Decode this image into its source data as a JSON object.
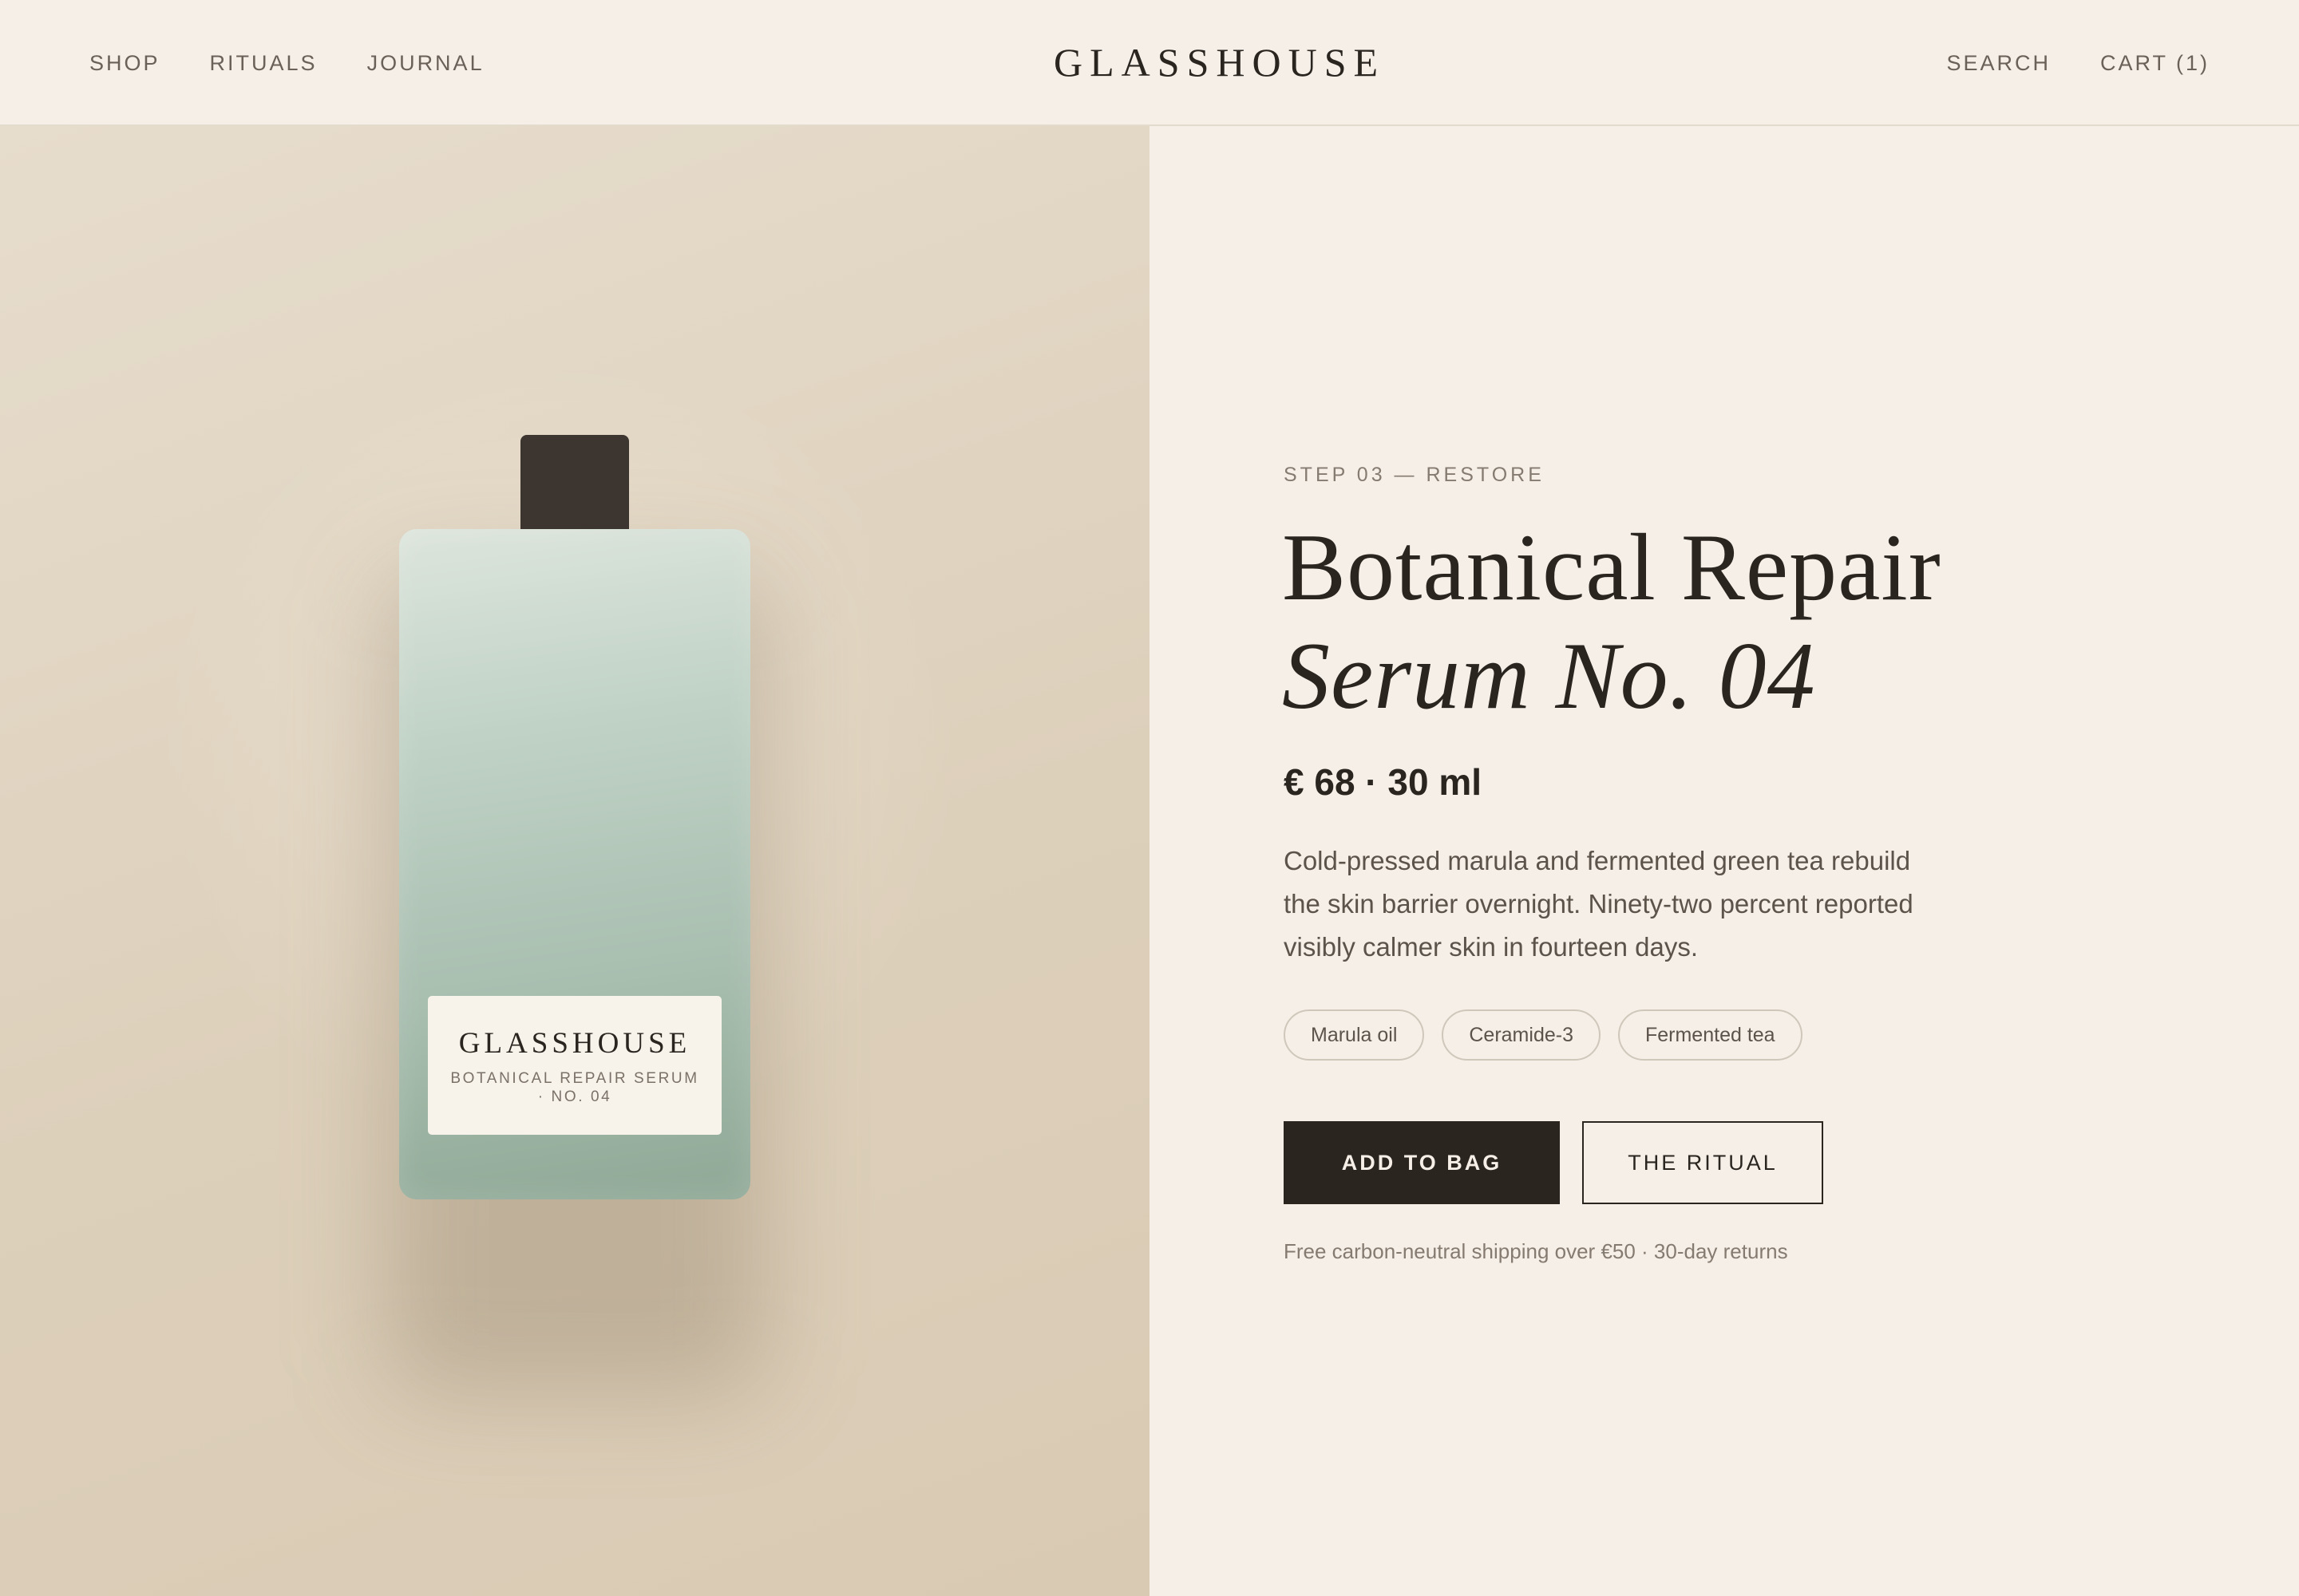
{
  "header": {
    "nav_left": [
      "SHOP",
      "RITUALS",
      "JOURNAL"
    ],
    "brand": "GLASSHOUSE",
    "search_label": "SEARCH",
    "cart_label": "CART (1)"
  },
  "product_image": {
    "label_brand": "GLASSHOUSE",
    "label_sub": "BOTANICAL REPAIR SERUM · NO. 04"
  },
  "product": {
    "eyebrow": "STEP 03 — RESTORE",
    "title_line1": "Botanical Repair",
    "title_line2": "Serum No. 04",
    "price": "€ 68 · 30 ml",
    "description": "Cold-pressed marula and fermented green tea rebuild the skin barrier overnight. Ninety-two percent reported visibly calmer skin in fourteen days.",
    "tags": [
      "Marula oil",
      "Ceramide-3",
      "Fermented tea"
    ],
    "primary_cta": "ADD TO BAG",
    "secondary_cta": "THE RITUAL",
    "shipping_note": "Free carbon-neutral shipping over €50 · 30-day returns"
  },
  "colors": {
    "ink": "#2b2520",
    "cream": "#f5efe8",
    "sand": "#e2d7c5",
    "bottle_green": "#a9bfb0",
    "cap": "#3d3630"
  }
}
